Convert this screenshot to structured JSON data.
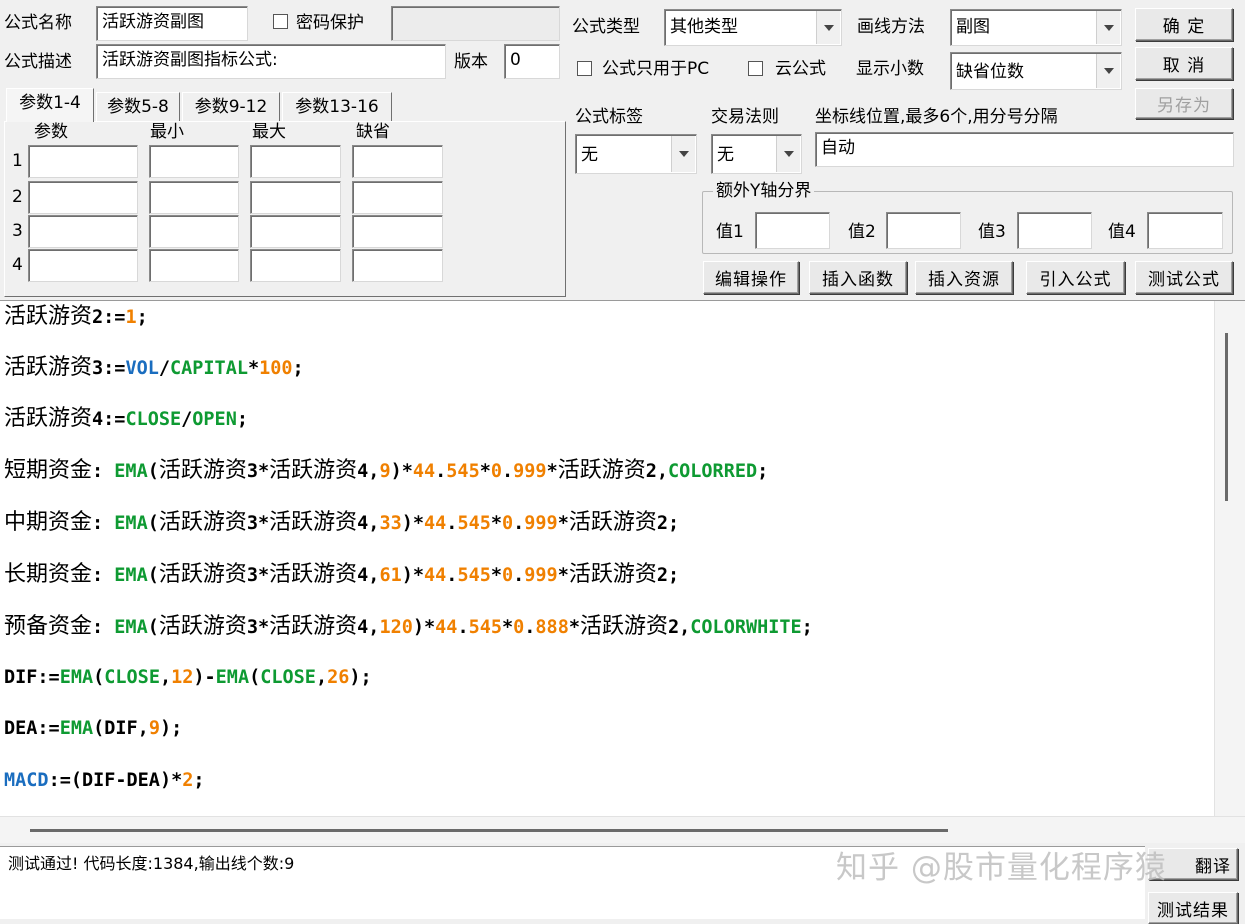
{
  "form": {
    "name_label": "公式名称",
    "name_value": "活跃游资副图",
    "password_label": "密码保护",
    "password_value": "",
    "desc_label": "公式描述",
    "desc_value": "活跃游资副图指标公式:",
    "version_label": "版本",
    "version_value": "0",
    "type_label": "公式类型",
    "type_value": "其他类型",
    "draw_label": "画线方法",
    "draw_value": "副图",
    "pc_only_label": "公式只用于PC",
    "cloud_label": "云公式",
    "decimals_label": "显示小数",
    "decimals_value": "缺省位数",
    "tag_label": "公式标签",
    "tag_value": "无",
    "rule_label": "交易法则",
    "rule_value": "无",
    "axis_label": "坐标线位置,最多6个,用分号分隔",
    "axis_value": "自动",
    "extra_y_label": "额外Y轴分界",
    "y_labels": [
      "值1",
      "值2",
      "值3",
      "值4"
    ]
  },
  "buttons": {
    "ok": "确 定",
    "cancel": "取 消",
    "save_as": "另存为",
    "edit_ops": "编辑操作",
    "insert_func": "插入函数",
    "insert_res": "插入资源",
    "import_formula": "引入公式",
    "test_formula": "测试公式",
    "translate": "翻译",
    "test_result": "测试结果"
  },
  "params": {
    "tabs": [
      "参数1-4",
      "参数5-8",
      "参数9-12",
      "参数13-16"
    ],
    "headers": [
      "参数",
      "最小",
      "最大",
      "缺省"
    ],
    "rows": [
      "1",
      "2",
      "3",
      "4"
    ]
  },
  "code": {
    "l1": [
      "活跃游资",
      "2:=",
      "1",
      ";"
    ],
    "l2": [
      "活跃游资",
      "3:=",
      "VOL",
      "/",
      "CAPITAL",
      "*",
      "100",
      ";"
    ],
    "l3": [
      "活跃游资",
      "4:=",
      "CLOSE",
      "/",
      "OPEN",
      ";"
    ],
    "l4": [
      "短期资金",
      ": ",
      "EMA",
      "(",
      "活跃游资",
      "3*",
      "活跃游资",
      "4,",
      "9",
      ")*",
      "44",
      ".",
      "545",
      "*",
      "0",
      ".",
      "999",
      "*",
      "活跃游资",
      "2,",
      "COLORRED",
      ";"
    ],
    "l5": [
      "中期资金",
      ": ",
      "EMA",
      "(",
      "活跃游资",
      "3*",
      "活跃游资",
      "4,",
      "33",
      ")*",
      "44",
      ".",
      "545",
      "*",
      "0",
      ".",
      "999",
      "*",
      "活跃游资",
      "2;"
    ],
    "l6": [
      "长期资金",
      ": ",
      "EMA",
      "(",
      "活跃游资",
      "3*",
      "活跃游资",
      "4,",
      "61",
      ")*",
      "44",
      ".",
      "545",
      "*",
      "0",
      ".",
      "999",
      "*",
      "活跃游资",
      "2;"
    ],
    "l7": [
      "预备资金",
      ": ",
      "EMA",
      "(",
      "活跃游资",
      "3*",
      "活跃游资",
      "4,",
      "120",
      ")*",
      "44",
      ".",
      "545",
      "*",
      "0",
      ".",
      "888",
      "*",
      "活跃游资",
      "2,",
      "COLORWHITE",
      ";"
    ],
    "l8": [
      "DIF:=",
      "EMA",
      "(",
      "CLOSE",
      ",",
      "12",
      ")-",
      "EMA",
      "(",
      "CLOSE",
      ",",
      "26",
      ");"
    ],
    "l9": [
      "DEA:=",
      "EMA",
      "(DIF,",
      "9",
      ");"
    ],
    "l10": [
      "MACD",
      ":=(DIF-DEA)*",
      "2",
      ";"
    ]
  },
  "result": {
    "message": "测试通过! 代码长度:1384,输出线个数:9"
  },
  "watermark": "知乎 @股市量化程序猿"
}
